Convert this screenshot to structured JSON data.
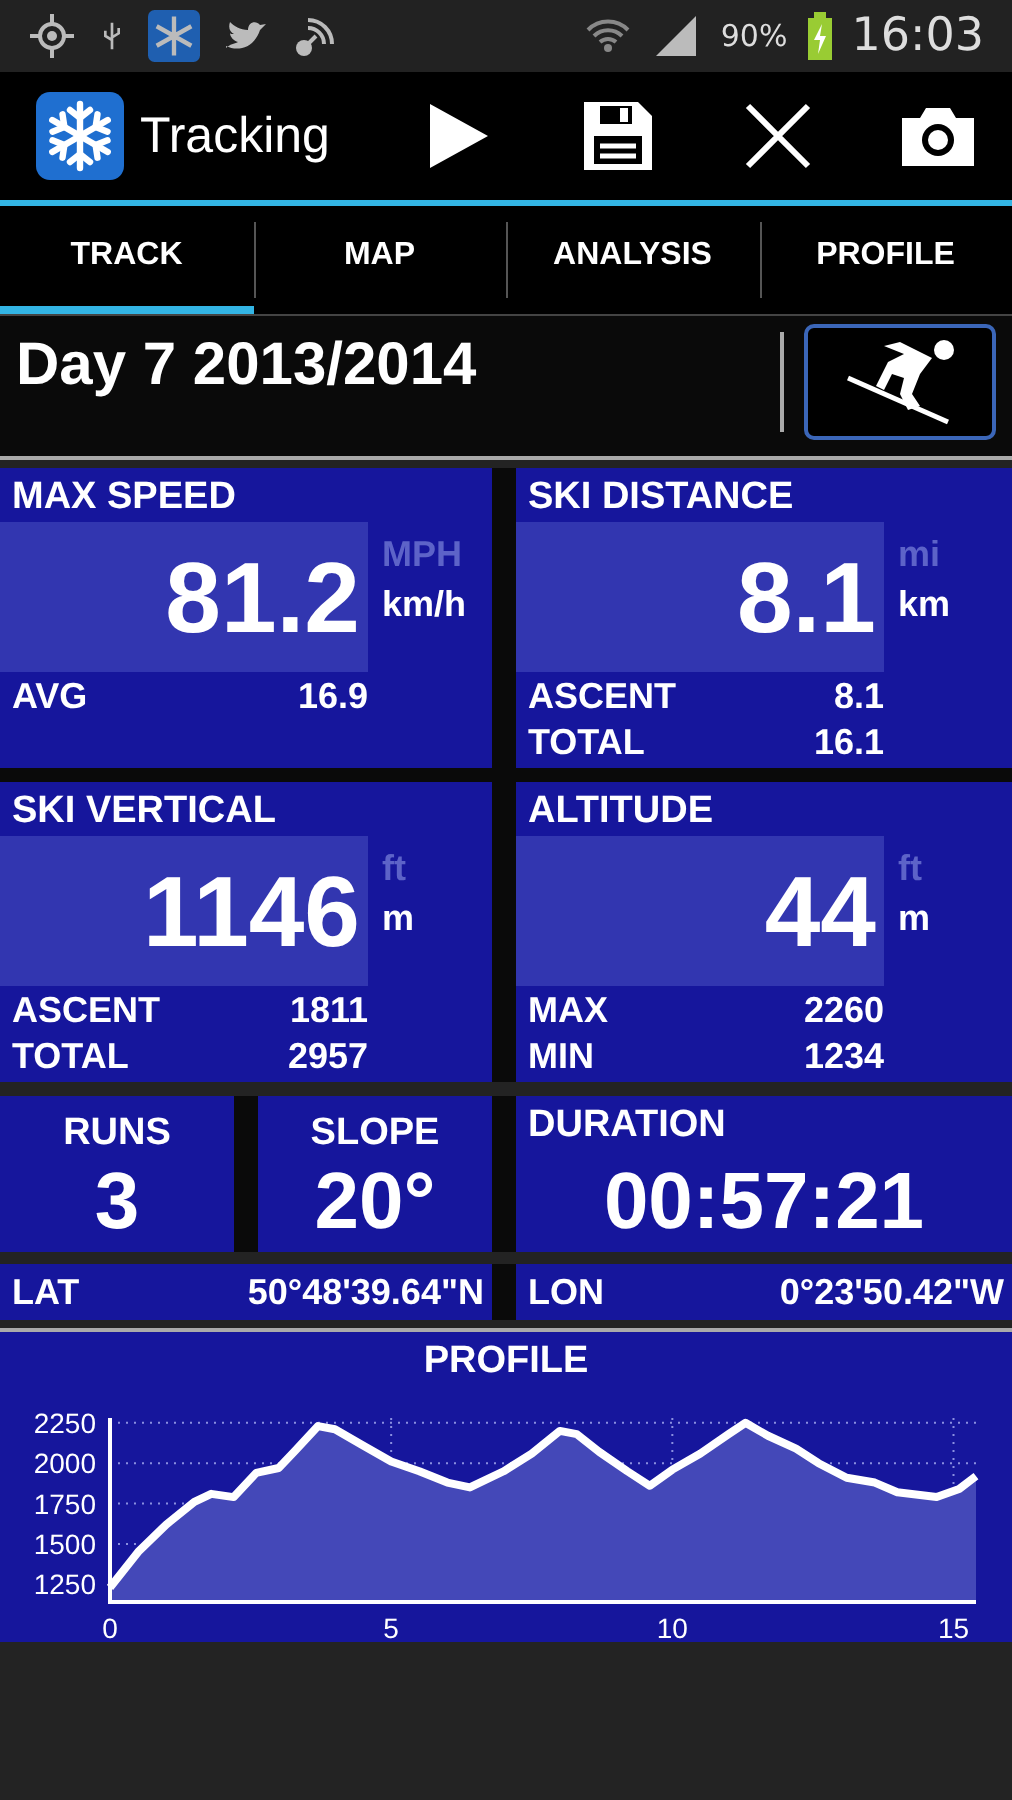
{
  "status_bar": {
    "battery": "90%",
    "time": "16:03"
  },
  "action_bar": {
    "title": "Tracking"
  },
  "tabs": [
    {
      "label": "TRACK",
      "selected": true
    },
    {
      "label": "MAP",
      "selected": false
    },
    {
      "label": "ANALYSIS",
      "selected": false
    },
    {
      "label": "PROFILE",
      "selected": false
    }
  ],
  "header": {
    "title": "Day 7 2013/2014"
  },
  "stats": [
    {
      "label": "MAX SPEED",
      "value": "81.2",
      "units": [
        {
          "label": "MPH",
          "selected": false
        },
        {
          "label": "km/h",
          "selected": true
        }
      ],
      "rows": [
        {
          "label": "AVG",
          "value": "16.9"
        }
      ]
    },
    {
      "label": "SKI DISTANCE",
      "value": "8.1",
      "units": [
        {
          "label": "mi",
          "selected": false
        },
        {
          "label": "km",
          "selected": true
        }
      ],
      "rows": [
        {
          "label": "ASCENT",
          "value": "8.1"
        },
        {
          "label": "TOTAL",
          "value": "16.1"
        }
      ]
    },
    {
      "label": "SKI VERTICAL",
      "value": "1146",
      "units": [
        {
          "label": "ft",
          "selected": false
        },
        {
          "label": "m",
          "selected": true
        }
      ],
      "rows": [
        {
          "label": "ASCENT",
          "value": "1811"
        },
        {
          "label": "TOTAL",
          "value": "2957"
        }
      ]
    },
    {
      "label": "ALTITUDE",
      "value": "44",
      "units": [
        {
          "label": "ft",
          "selected": false
        },
        {
          "label": "m",
          "selected": true
        }
      ],
      "rows": [
        {
          "label": "MAX",
          "value": "2260"
        },
        {
          "label": "MIN",
          "value": "1234"
        }
      ]
    }
  ],
  "counters": [
    {
      "label": "RUNS",
      "value": "3"
    },
    {
      "label": "SLOPE",
      "value": "20°"
    }
  ],
  "duration": {
    "label": "DURATION",
    "value": "00:57:21"
  },
  "coordinates": [
    {
      "label": "LAT",
      "value": "50°48'39.64\"N"
    },
    {
      "label": "LON",
      "value": "0°23'50.42\"W"
    }
  ],
  "profile": {
    "chart_data": {
      "type": "area",
      "title": "PROFILE",
      "x": [
        0,
        0.5,
        1,
        1.5,
        1.8,
        2.2,
        2.6,
        3,
        3.3,
        3.7,
        4,
        4.5,
        5,
        5.5,
        6,
        6.4,
        7,
        7.5,
        8,
        8.3,
        8.7,
        9.2,
        9.6,
        10,
        10.5,
        11,
        11.3,
        11.7,
        12.2,
        12.6,
        13.1,
        13.6,
        14,
        14.7,
        15.1,
        15.4
      ],
      "series": [
        {
          "color": "#ffffff",
          "values": [
            1230,
            1450,
            1620,
            1760,
            1810,
            1790,
            1940,
            1970,
            2080,
            2230,
            2210,
            2110,
            2010,
            1950,
            1880,
            1850,
            1950,
            2060,
            2200,
            2180,
            2070,
            1950,
            1860,
            1960,
            2060,
            2180,
            2250,
            2170,
            2090,
            2000,
            1910,
            1880,
            1820,
            1790,
            1840,
            1920
          ]
        }
      ],
      "grid": true,
      "xlim": [
        0,
        15.4
      ],
      "ylim": [
        1140,
        2280
      ],
      "xticks": [
        0,
        5,
        10,
        15
      ],
      "yticks": [
        1250,
        1500,
        1750,
        2000,
        2250
      ]
    }
  }
}
